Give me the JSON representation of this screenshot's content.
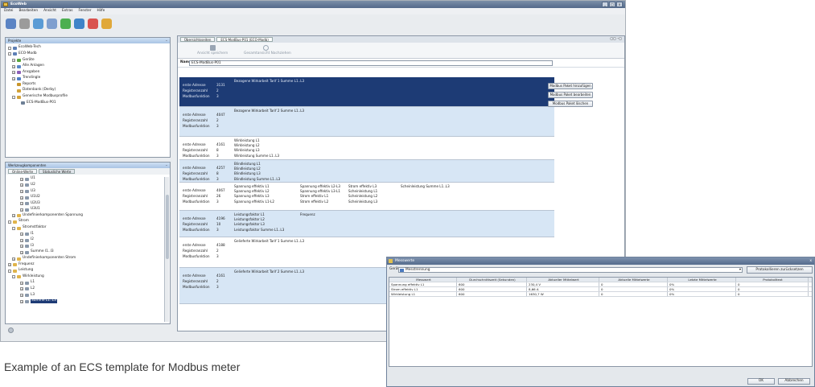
{
  "app": {
    "title": "EcoWeb",
    "window_controls": [
      "_",
      "□",
      "x"
    ]
  },
  "menu": [
    "Datei",
    "Bearbeiten",
    "Ansicht",
    "Extras",
    "Fenster",
    "Hilfe"
  ],
  "toolbar_icons": [
    "save-icon",
    "copy-icon",
    "refresh-icon",
    "undo-icon",
    "green-circle-icon",
    "network-icon",
    "stop-icon",
    "wand-icon"
  ],
  "project_pane": {
    "title": "Projekte",
    "tree": [
      {
        "label": "EcoWeb-Tech",
        "level": 0,
        "exp": "-",
        "icon": "#5d7fb5"
      },
      {
        "label": "ECO-Modb",
        "level": 0,
        "exp": "-",
        "icon": "#5d7fb5"
      },
      {
        "label": "Geräte",
        "level": 1,
        "exp": "+",
        "icon": "#5aa63f"
      },
      {
        "label": "Alle Anlagen",
        "level": 1,
        "exp": "+",
        "icon": "#5a88c8"
      },
      {
        "label": "Ansgaben",
        "level": 1,
        "exp": "+",
        "icon": "#8c5fb8"
      },
      {
        "label": "Trendingle",
        "level": 1,
        "exp": "+",
        "icon": "#4e7fc4"
      },
      {
        "label": "Reports",
        "level": 1,
        "exp": "",
        "icon": "#c8952b"
      },
      {
        "label": "Datenbank (Derby)",
        "level": 1,
        "exp": "",
        "icon": "#d2a23a"
      },
      {
        "label": "Generische Modbusprofile",
        "level": 1,
        "exp": "-",
        "icon": "#d2a23a"
      },
      {
        "label": "ECS-ModBus-P01",
        "level": 2,
        "exp": "",
        "icon": "#6d7f95"
      }
    ]
  },
  "component_pane": {
    "title": "Werkzeugkomponenten",
    "tabs": [
      "Online-Werte",
      "Statusliche Werte"
    ],
    "tree": [
      {
        "label": "U1",
        "level": 3,
        "exp": "+"
      },
      {
        "label": "U2",
        "level": 3,
        "exp": "+"
      },
      {
        "label": "U3",
        "level": 3,
        "exp": "+"
      },
      {
        "label": "U1U2",
        "level": 3,
        "exp": "+"
      },
      {
        "label": "U2U3",
        "level": 3,
        "exp": "+"
      },
      {
        "label": "U3U1",
        "level": 3,
        "exp": "+"
      },
      {
        "label": "Undefinierkomponenten Spannung",
        "level": 1,
        "exp": "+"
      },
      {
        "label": "Strom",
        "level": 0,
        "exp": "-"
      },
      {
        "label": "Stromstfaktor",
        "level": 1,
        "exp": "-"
      },
      {
        "label": "I1",
        "level": 3,
        "exp": "+"
      },
      {
        "label": "I2",
        "level": 3,
        "exp": "+"
      },
      {
        "label": "I3",
        "level": 3,
        "exp": "+"
      },
      {
        "label": "Summe I1..I3",
        "level": 3,
        "exp": "+"
      },
      {
        "label": "Undefinierkomponenten Strom",
        "level": 1,
        "exp": "+"
      },
      {
        "label": "Frequenz",
        "level": 0,
        "exp": "+"
      },
      {
        "label": "Leistung",
        "level": 0,
        "exp": "-"
      },
      {
        "label": "Wirkleistung",
        "level": 1,
        "exp": "-"
      },
      {
        "label": "L1",
        "level": 3,
        "exp": "+"
      },
      {
        "label": "L2",
        "level": 3,
        "exp": "+"
      },
      {
        "label": "L3",
        "level": 3,
        "exp": "+"
      },
      {
        "label": "Summe L1..L3",
        "level": 3,
        "exp": "+",
        "selected": true
      }
    ]
  },
  "editor": {
    "tabs": [
      "Übersichtsseiten",
      "ECS-ModBus-P01 (ECO-Modb)"
    ],
    "toolbar": [
      "Ansicht speichern",
      "Gesamtansicht Nachziehen"
    ],
    "name_label": "Name",
    "name_value": "ECS-ModBus-P01",
    "row_labels": [
      "erste Adresse",
      "Registeranzahl",
      "Modbusfunktion"
    ],
    "rows": [
      {
        "values": [
          "3131",
          "2",
          "3"
        ],
        "col1": [
          "Bezogene Wirkarbeit Tarif 1 Summe L1..L3"
        ],
        "col2": [],
        "col3": [],
        "col4": [],
        "selected": true
      },
      {
        "values": [
          "4047",
          "2",
          "3"
        ],
        "col1": [
          "Bezogene Wirkarbeit Tarif 2 Summe L1..L3"
        ],
        "col2": [],
        "col3": [],
        "col4": []
      },
      {
        "values": [
          "4161",
          "8",
          "3"
        ],
        "col1": [
          "Wirkleistung L1",
          "Wirkleistung L2",
          "Wirkleistung L3",
          "Wirkleistung Summe L1..L3"
        ],
        "col2": [],
        "col3": [],
        "col4": []
      },
      {
        "values": [
          "4257",
          "8",
          "3"
        ],
        "col1": [
          "Blindleistung L1",
          "Blindleistung L2",
          "Blindleistung L3",
          "Blindleistung Summe L1..L3"
        ],
        "col2": [],
        "col3": [],
        "col4": []
      },
      {
        "values": [
          "4067",
          "26",
          "3"
        ],
        "col1": [
          "Spannung effektiv L1",
          "Spannung effektiv L2",
          "Spannung effektiv L3",
          "Spannung effektiv L1-L2"
        ],
        "col2": [
          "Spannung effektiv L2-L3",
          "Spannung effektiv L3-L1",
          "Strom effektiv L1",
          "Strom effektiv L2"
        ],
        "col3": [
          "Strom effektiv L3",
          "Scheinleistung L1",
          "Scheinleistung L2",
          "Scheinleistung L3"
        ],
        "col4": [
          "Scheinleistung Summe L1..L3"
        ]
      },
      {
        "values": [
          "4196",
          "10",
          "3"
        ],
        "col1": [
          "Leistungsfaktor L1",
          "Leistungsfaktor L2",
          "Leistungsfaktor L3",
          "Leistungsfaktor Summe L1..L3"
        ],
        "col2": [
          "Frequenz"
        ],
        "col3": [],
        "col4": []
      },
      {
        "values": [
          "4188",
          "2",
          "3"
        ],
        "col1": [
          "Gelieferte Wirkarbeit Tarif 1 Summe L1..L3"
        ],
        "col2": [],
        "col3": [],
        "col4": []
      },
      {
        "values": [
          "4161",
          "2",
          "3"
        ],
        "col1": [
          "Gelieferte Wirkarbeit Tarif 2 Summe L1..L3"
        ],
        "col2": [],
        "col3": [],
        "col4": []
      }
    ],
    "buttons": [
      "Modbus Paket hinzufügen",
      "Modbus Paket bearbeiten",
      "Modbus Paket löschen"
    ]
  },
  "dialog": {
    "title": "Messwerte",
    "device_label": "Gerät",
    "device_value": "Messtrennung",
    "apply_button": "Protokollieren zurücksetzen",
    "columns": [
      "Messwert",
      "Durchschnittszeit (Sekunden)",
      "Aktueller Mittelwert",
      "Aktuelle Mittelwerte",
      "Letzte Mittelwerte",
      "Protokolltext"
    ],
    "rows": [
      [
        "Spannung effektiv L1",
        "600",
        "230,4 V",
        "0",
        "0%",
        "0"
      ],
      [
        "Strom effektiv L1",
        "600",
        "8,66 A",
        "0",
        "0%",
        "0"
      ],
      [
        "Wirkleistung L1",
        "600",
        "1630,7 W",
        "0",
        "0%",
        "0"
      ]
    ],
    "ok_button": "OK",
    "cancel_button": "Abbrechen"
  },
  "caption": "Example of an ECS template for Modbus meter",
  "colors": {
    "selected_row": "#1d3b75",
    "light_row": "#d7e6f5",
    "white_row": "#ffffff"
  }
}
